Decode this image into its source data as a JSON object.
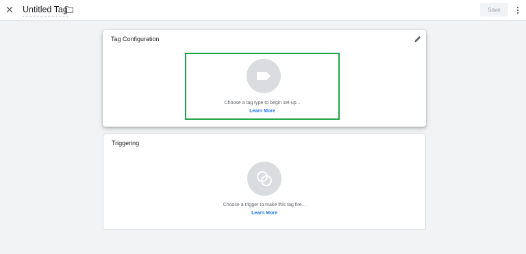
{
  "header": {
    "tag_name": "Untitled Tag",
    "save_label": "Save"
  },
  "tag_configuration": {
    "title": "Tag Configuration",
    "hint": "Choose a tag type to begin set-up...",
    "learn_more": "Learn More"
  },
  "triggering": {
    "title": "Triggering",
    "hint": "Choose a trigger to make this tag fire...",
    "learn_more": "Learn More"
  },
  "colors": {
    "highlight": "#1ea446",
    "link": "#1a73e8",
    "background": "#f1f3f4",
    "placeholder_circle": "#dadce0"
  },
  "icons": [
    "close-icon",
    "folder-icon",
    "more-vert-icon",
    "pencil-icon",
    "tag-type-icon",
    "trigger-icon"
  ]
}
